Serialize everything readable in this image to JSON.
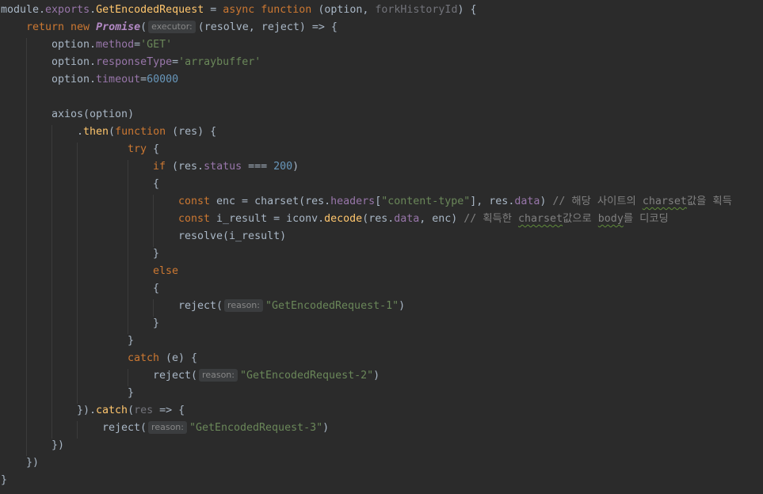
{
  "code": {
    "l1": {
      "a": "module.",
      "b": "exports",
      "c": ".",
      "d": "GetEncodedRequest",
      "e": " = ",
      "f": "async function",
      "g": " (option, ",
      "h": "forkHistoryId",
      "i": ") {"
    },
    "l2": {
      "a": "return new",
      "b": " ",
      "c": "Promise",
      "d": "(",
      "hint": "executor:",
      "e": "(resolve, reject) => {"
    },
    "l3": {
      "a": "option.",
      "b": "method",
      "c": "=",
      "d": "'GET'"
    },
    "l4": {
      "a": "option.",
      "b": "responseType",
      "c": "=",
      "d": "'arraybuffer'"
    },
    "l5": {
      "a": "option.",
      "b": "timeout",
      "c": "=",
      "d": "60000"
    },
    "l7": {
      "a": "axios(option)"
    },
    "l8": {
      "a": ".",
      "b": "then",
      "c": "(",
      "d": "function",
      "e": " (res) {"
    },
    "l9": {
      "a": "try",
      "b": " {"
    },
    "l10": {
      "a": "if",
      "b": " (res.",
      "c": "status",
      "d": " === ",
      "e": "200",
      "f": ")"
    },
    "l11": {
      "a": "{"
    },
    "l12": {
      "a": "const",
      "b": " enc = charset(res.",
      "c": "headers",
      "d": "[",
      "e": "\"content-type\"",
      "f": "], res.",
      "g": "data",
      "h": ") ",
      "i": "// 해당 사이트의 ",
      "j": "charset",
      "k": "값을 획득"
    },
    "l13": {
      "a": "const",
      "b": " i_result = iconv.",
      "c": "decode",
      "d": "(res.",
      "e": "data",
      "f": ", enc) ",
      "g": "// 획득한 ",
      "h": "charset",
      "i": "값으로 ",
      "j": "body",
      "k": "를 디코딩"
    },
    "l14": {
      "a": "resolve(i_result)"
    },
    "l15": {
      "a": "}"
    },
    "l16": {
      "a": "else"
    },
    "l17": {
      "a": "{"
    },
    "l18": {
      "a": "reject(",
      "hint": "reason:",
      "b": "\"GetEncodedRequest-1\"",
      "c": ")"
    },
    "l19": {
      "a": "}"
    },
    "l20": {
      "a": "}"
    },
    "l21": {
      "a": "catch",
      "b": " (e) {"
    },
    "l22": {
      "a": "reject(",
      "hint": "reason:",
      "b": "\"GetEncodedRequest-2\"",
      "c": ")"
    },
    "l23": {
      "a": "}"
    },
    "l24": {
      "a": "}).",
      "b": "catch",
      "c": "(",
      "d": "res",
      "e": " => {"
    },
    "l25": {
      "a": "reject(",
      "hint": "reason:",
      "b": "\"GetEncodedRequest-3\"",
      "c": ")"
    },
    "l26": {
      "a": "})"
    },
    "l27": {
      "a": "})"
    },
    "l28": {
      "a": "}"
    }
  },
  "theme": {
    "background": "#2b2b2b",
    "text": "#a9b7c6",
    "keyword": "#cc7832",
    "function": "#ffc66d",
    "property": "#9876aa",
    "string": "#6a8759",
    "number": "#6897bb",
    "comment": "#808080"
  }
}
